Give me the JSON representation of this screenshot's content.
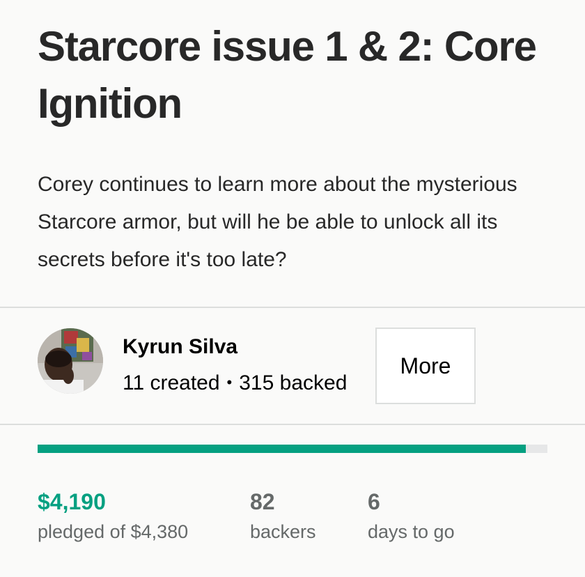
{
  "project": {
    "title": "Starcore issue 1 & 2: Core Ignition",
    "blurb": "Corey continues to learn more about the mysterious Starcore armor, but will he be able to unlock all its secrets before it's too late?"
  },
  "creator": {
    "name": "Kyrun Silva",
    "created": "11 created",
    "separator": "•",
    "backed": "315 backed",
    "more_label": "More",
    "avatar_icon": "creator-photo"
  },
  "funding": {
    "progress_fraction": 0.957,
    "pledged": "$4,190",
    "pledged_label": "pledged of $4,380",
    "backers": "82",
    "backers_label": "backers",
    "days": "6",
    "days_label": "days to go"
  },
  "colors": {
    "accent": "#05a081",
    "muted_text": "#656969",
    "divider": "#dcdedd",
    "track": "#e6e7e8"
  }
}
